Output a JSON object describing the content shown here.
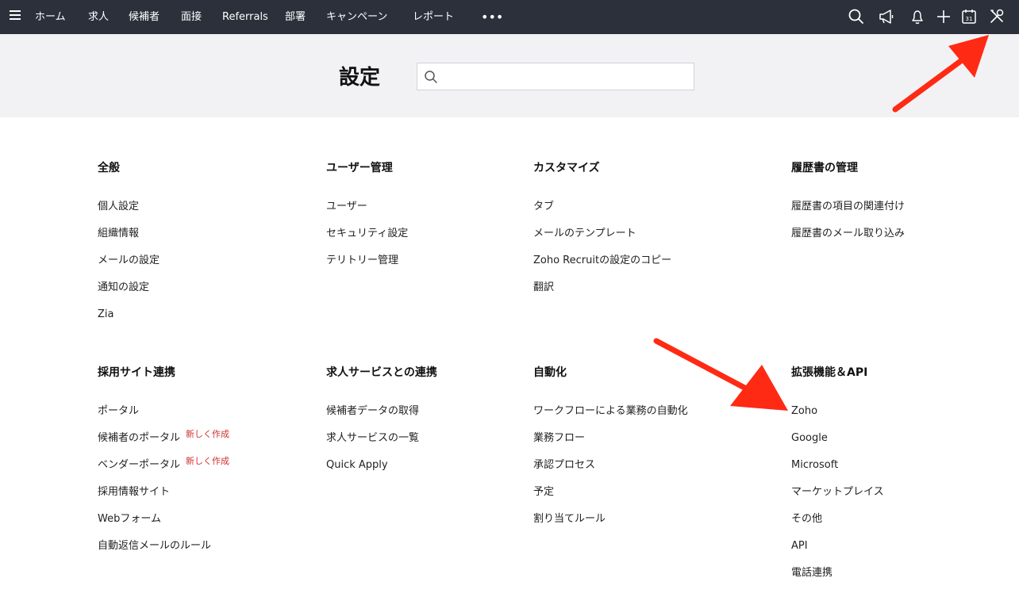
{
  "nav": {
    "items": [
      "ホーム",
      "求人",
      "候補者",
      "面接",
      "Referrals",
      "部署",
      "キャンペーン",
      "レポート"
    ],
    "more": "•••"
  },
  "icons": [
    "search-icon",
    "announcement-icon",
    "bell-icon",
    "plus-icon",
    "calendar-icon",
    "setup-tools-icon"
  ],
  "calendar_day": "31",
  "header": {
    "title": "設定",
    "search_placeholder": ""
  },
  "badge_new": "新しく作成",
  "colors": {
    "topbar": "#2b303b",
    "header_bg": "#f2f2f4",
    "badge": "#d0312d",
    "annotation_arrow": "#ff2a14"
  },
  "sections": {
    "general": {
      "title": "全般",
      "items": [
        "個人設定",
        "組織情報",
        "メールの設定",
        "通知の設定",
        "Zia"
      ]
    },
    "users": {
      "title": "ユーザー管理",
      "items": [
        "ユーザー",
        "セキュリティ設定",
        "テリトリー管理"
      ]
    },
    "customize": {
      "title": "カスタマイズ",
      "items": [
        "タブ",
        "メールのテンプレート",
        "Zoho Recruitの設定のコピー",
        "翻訳"
      ]
    },
    "resume": {
      "title": "履歴書の管理",
      "items": [
        "履歴書の項目の関連付け",
        "履歴書のメール取り込み"
      ]
    },
    "career": {
      "title": "採用サイト連携",
      "items": [
        "ポータル",
        "候補者のポータル",
        "ベンダーポータル",
        "採用情報サイト",
        "Webフォーム",
        "自動返信メールのルール"
      ]
    },
    "jobboards": {
      "title": "求人サービスとの連携",
      "items": [
        "候補者データの取得",
        "求人サービスの一覧",
        "Quick Apply"
      ]
    },
    "automation": {
      "title": "自動化",
      "items": [
        "ワークフローによる業務の自動化",
        "業務フロー",
        "承認プロセス",
        "予定",
        "割り当てルール"
      ]
    },
    "extensions": {
      "title": "拡張機能＆API",
      "items": [
        "Zoho",
        "Google",
        "Microsoft",
        "マーケットプレイス",
        "その他",
        "API",
        "電話連携"
      ]
    }
  }
}
